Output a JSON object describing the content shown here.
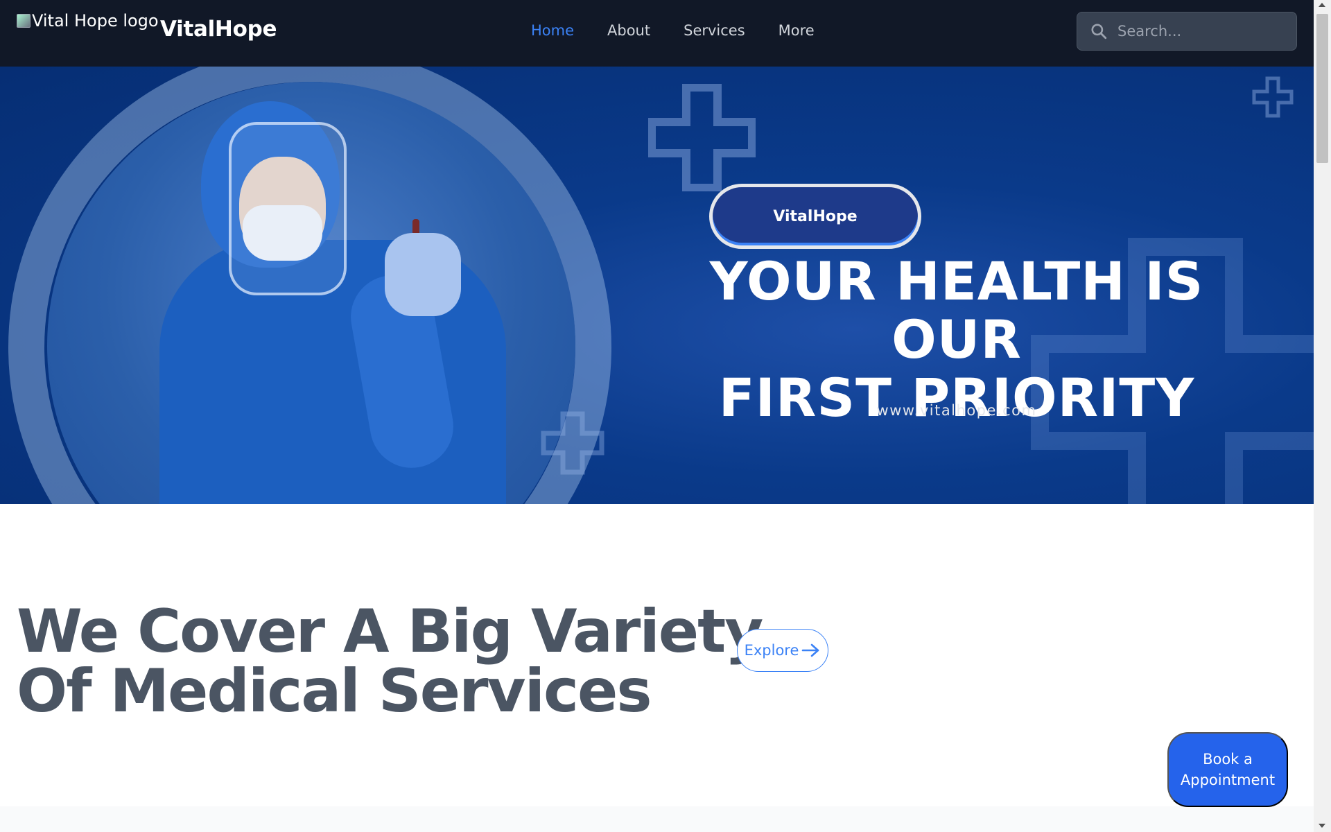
{
  "header": {
    "logo_alt": "Vital Hope logo",
    "brand": "VitalHope",
    "nav": [
      {
        "label": "Home",
        "active": true
      },
      {
        "label": "About",
        "active": false
      },
      {
        "label": "Services",
        "active": false
      },
      {
        "label": "More",
        "active": false
      }
    ],
    "search": {
      "placeholder": "Search...",
      "icon": "search-icon"
    }
  },
  "hero": {
    "badge": "VitalHope",
    "headline_line1": "YOUR HEALTH IS OUR",
    "headline_line2": "FIRST PRIORITY",
    "url": "www.vitalhope.com"
  },
  "services": {
    "title_line1": "We Cover A Big Variety",
    "title_line2": "Of Medical Services",
    "explore_label": "Explore",
    "explore_icon": "arrow-right-icon"
  },
  "floating": {
    "book_line1": "Book a",
    "book_line2": "Appointment"
  },
  "colors": {
    "navbar_bg": "#111827",
    "accent": "#3b82f6",
    "hero_bg": "#0a3a8a",
    "book_button": "#2563eb",
    "title_text": "#4b5563"
  }
}
